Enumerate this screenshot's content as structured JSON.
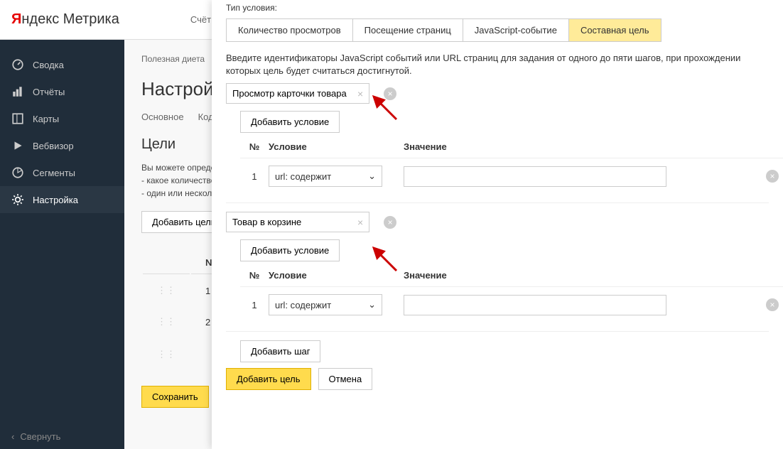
{
  "logo": {
    "y": "Я",
    "ndex": "ндекс",
    "metrika": " Метрика"
  },
  "topbar": {
    "accounts": "Счёт"
  },
  "sidebar": {
    "items": [
      {
        "icon": "gauge",
        "label": "Сводка"
      },
      {
        "icon": "chart",
        "label": "Отчёты"
      },
      {
        "icon": "map",
        "label": "Карты"
      },
      {
        "icon": "play",
        "label": "Вебвизор"
      },
      {
        "icon": "segment",
        "label": "Сегменты"
      },
      {
        "icon": "gear",
        "label": "Настройка"
      }
    ],
    "collapse": "Свернуть"
  },
  "main": {
    "breadcrumb": "Полезная диета",
    "title": "Настройки",
    "tabs": [
      "Основное",
      "Код"
    ],
    "goals_title": "Цели",
    "help1": "Вы можете определить",
    "help2": "- какое количество",
    "help3": "- один или несколько",
    "add_goal": "Добавить цель",
    "col_num": "№",
    "rows": [
      {
        "num": "1"
      },
      {
        "num": "2"
      },
      {
        "num": ""
      }
    ],
    "save": "Сохранить"
  },
  "modal": {
    "type_label": "Тип условия:",
    "type_tabs": [
      "Количество просмотров",
      "Посещение страниц",
      "JavaScript-событие",
      "Составная цель"
    ],
    "help": "Введите идентификаторы JavaScript событий или URL страниц для задания от одного до пяти шагов, при прохождении которых цель будет считаться достигнутой.",
    "steps": [
      {
        "name": "Просмотр карточки товара",
        "add_cond": "Добавить условие",
        "col_num": "№",
        "col_cond": "Условие",
        "col_val": "Значение",
        "rows": [
          {
            "num": "1",
            "cond": "url: содержит",
            "val": ""
          }
        ]
      },
      {
        "name": "Товар в корзине",
        "add_cond": "Добавить условие",
        "col_num": "№",
        "col_cond": "Условие",
        "col_val": "Значение",
        "rows": [
          {
            "num": "1",
            "cond": "url: содержит",
            "val": ""
          }
        ]
      }
    ],
    "add_step": "Добавить шаг",
    "submit": "Добавить цель",
    "cancel": "Отмена"
  }
}
